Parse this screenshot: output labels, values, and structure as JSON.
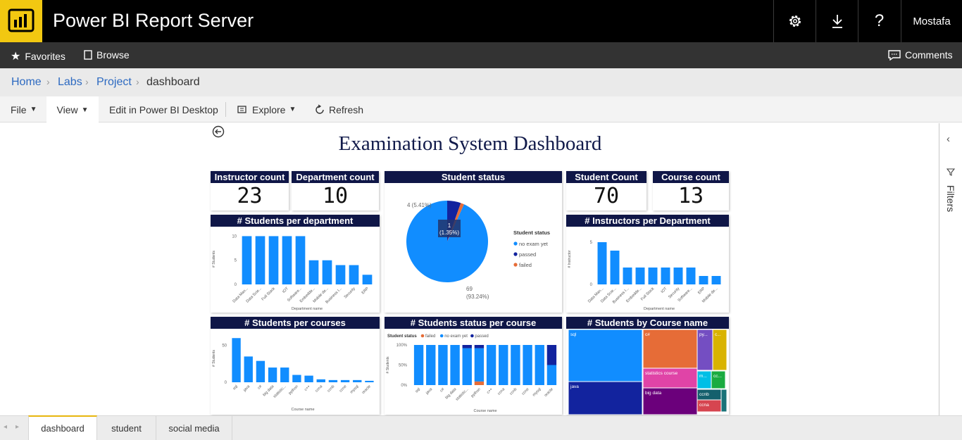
{
  "app": {
    "title": "Power BI Report Server",
    "user": "Mostafa"
  },
  "nav": {
    "favorites": "Favorites",
    "browse": "Browse",
    "comments": "Comments"
  },
  "breadcrumb": [
    "Home",
    "Labs",
    "Project",
    "dashboard"
  ],
  "toolbar": {
    "file": "File",
    "view": "View",
    "edit": "Edit in Power BI Desktop",
    "explore": "Explore",
    "refresh": "Refresh"
  },
  "rightpane": {
    "filters": "Filters"
  },
  "tabs": [
    "dashboard",
    "student",
    "social media"
  ],
  "dashboard": {
    "title": "Examination System Dashboard",
    "kpis": [
      {
        "label": "Instructor count",
        "value": "23"
      },
      {
        "label": "Department count",
        "value": "10"
      },
      {
        "label": "Student Count",
        "value": "70"
      },
      {
        "label": "Course count",
        "value": "13"
      }
    ],
    "tile_titles": {
      "student_status": "Student status",
      "students_per_department": "# Students per department",
      "instructors_per_department": "# Instructors per Department",
      "students_per_courses": "# Students per courses",
      "status_per_course": "# Students status per course",
      "students_by_course_name": "# Students by Course name"
    }
  },
  "colors": {
    "brand": "#f2c811",
    "header": "#0f1647",
    "bar": "#118dff",
    "dark": "#12239e",
    "orange": "#e66c37"
  },
  "chart_data": [
    {
      "id": "students_per_department",
      "type": "bar",
      "categories": [
        "Data Man...",
        "Data Scie...",
        "Full Stack",
        "IOT",
        "Software...",
        "Embedde...",
        "Mobile de...",
        "Business I...",
        "Security",
        "ERP"
      ],
      "values": [
        10,
        10,
        10,
        10,
        10,
        5,
        5,
        4,
        4,
        2
      ],
      "xlabel": "Department name",
      "ylabel": "# Students",
      "yticks": [
        0,
        5,
        10
      ],
      "ylim": [
        0,
        10.5
      ]
    },
    {
      "id": "instructors_per_department",
      "type": "bar",
      "categories": [
        "Data Man...",
        "Data Scie...",
        "Business I...",
        "Embedde...",
        "Full Stack",
        "IOT",
        "Security",
        "Software...",
        "ERP",
        "Mobile de..."
      ],
      "values": [
        5,
        4,
        2,
        2,
        2,
        2,
        2,
        2,
        1,
        1
      ],
      "xlabel": "Department name",
      "ylabel": "# Instructor",
      "yticks": [
        0,
        5
      ],
      "ylim": [
        0,
        6
      ]
    },
    {
      "id": "student_status",
      "type": "pie",
      "legend_title": "Student status",
      "slices": [
        {
          "name": "no exam yet",
          "value": 69,
          "label": "69",
          "pct": "(93.24%)",
          "color": "#118dff"
        },
        {
          "name": "passed",
          "value": 4,
          "label": "4 (5.41%)",
          "color": "#12239e"
        },
        {
          "name": "failed",
          "value": 1,
          "label": "1",
          "pct": "(1.35%)",
          "color": "#e66c37"
        }
      ]
    },
    {
      "id": "students_per_courses",
      "type": "bar",
      "categories": [
        "sql",
        "java",
        "c#",
        "big data",
        "statistic...",
        "python",
        "c++",
        "ccna",
        "ccnb",
        "ccne",
        "mysql",
        "oracle"
      ],
      "values": [
        60,
        35,
        29,
        20,
        20,
        10,
        9,
        4,
        3,
        3,
        3,
        2
      ],
      "xlabel": "Course name",
      "ylabel": "# Students",
      "yticks": [
        0,
        50
      ],
      "ylim": [
        0,
        65
      ]
    },
    {
      "id": "status_per_course",
      "type": "bar",
      "stacked": true,
      "legend_title": "Student status",
      "categories": [
        "sql",
        "java",
        "c#",
        "big data",
        "statistic...",
        "python",
        "c++",
        "ccna",
        "ccnb",
        "ccne",
        "mysql",
        "oracle"
      ],
      "series": [
        {
          "name": "failed",
          "color": "#e66c37",
          "values": [
            0,
            0,
            0,
            0,
            0,
            9,
            0,
            0,
            0,
            0,
            0,
            0
          ]
        },
        {
          "name": "no exam yet",
          "color": "#118dff",
          "values": [
            100,
            100,
            100,
            100,
            92,
            83,
            100,
            100,
            100,
            100,
            100,
            50
          ]
        },
        {
          "name": "passed",
          "color": "#12239e",
          "values": [
            0,
            0,
            0,
            0,
            8,
            8,
            0,
            0,
            0,
            0,
            0,
            50
          ]
        }
      ],
      "xlabel": "Course name",
      "ylabel": "# Students",
      "yticks": [
        "0%",
        "50%",
        "100%"
      ]
    },
    {
      "id": "students_by_course_name",
      "type": "treemap",
      "items": [
        {
          "name": "sql",
          "color": "#118dff"
        },
        {
          "name": "java",
          "color": "#12239e"
        },
        {
          "name": "c#",
          "color": "#e66c37"
        },
        {
          "name": "statistics course",
          "color": "#e044a7"
        },
        {
          "name": "big data",
          "color": "#6b007b"
        },
        {
          "name": "py...",
          "color": "#744ec2"
        },
        {
          "name": "c...",
          "color": "#d9b300"
        },
        {
          "name": "m...",
          "color": "#00bfe6"
        },
        {
          "name": "cc...",
          "color": "#1aab40"
        },
        {
          "name": "ccnb",
          "color": "#15606d"
        },
        {
          "name": "ccna",
          "color": "#d64550"
        },
        {
          "name": "",
          "color": "#197278"
        }
      ]
    }
  ]
}
